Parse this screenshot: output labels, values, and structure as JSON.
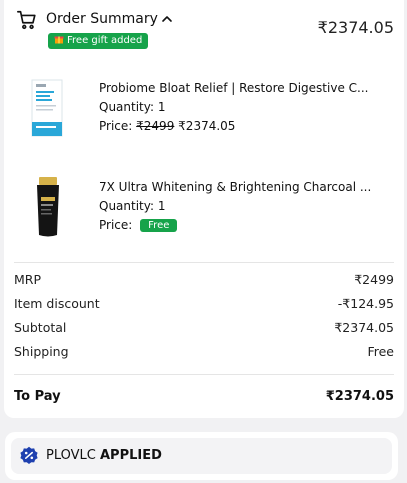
{
  "header": {
    "title": "Order Summary",
    "gift_badge": "Free gift added",
    "total": "₹2374.05"
  },
  "items": [
    {
      "name": "Probiome Bloat Relief | Restore Digestive C...",
      "quantity": "Quantity: 1",
      "price_label": "Price:",
      "original_price": "₹2499",
      "price": "₹2374.05"
    },
    {
      "name": "7X Ultra Whitening & Brightening Charcoal ...",
      "quantity": "Quantity: 1",
      "price_label": "Price:",
      "free_label": "Free"
    }
  ],
  "summary": {
    "mrp_label": "MRP",
    "mrp_value": "₹2499",
    "discount_label": "Item discount",
    "discount_value": "-₹124.95",
    "subtotal_label": "Subtotal",
    "subtotal_value": "₹2374.05",
    "shipping_label": "Shipping",
    "shipping_value": "Free",
    "topay_label": "To Pay",
    "topay_value": "₹2374.05"
  },
  "coupon": {
    "code": "PLOVLC",
    "status": "APPLIED"
  },
  "colors": {
    "accent_green": "#16a34a",
    "coupon_icon": "#1e40af"
  },
  "icons": [
    "cart-icon",
    "chevron-up-icon",
    "gift-icon",
    "discount-badge-icon"
  ]
}
